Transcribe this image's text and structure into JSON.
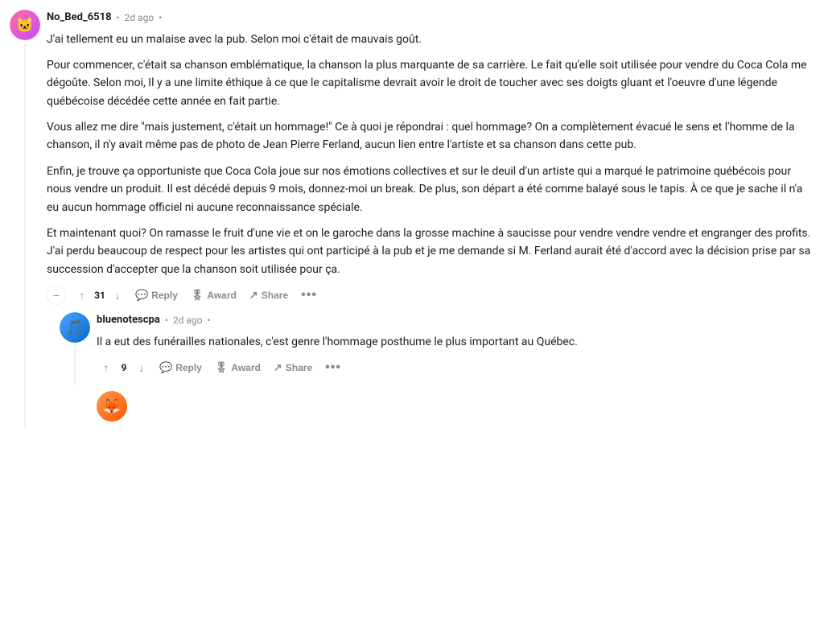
{
  "comments": [
    {
      "id": "main",
      "username": "No_Bed_6518",
      "timestamp": "2d ago",
      "avatarEmoji": "🐱",
      "avatarClass": "avatar-no-bed",
      "paragraphs": [
        "J'ai tellement eu un malaise avec la pub. Selon moi c'était de mauvais goût.",
        "Pour commencer, c'était sa chanson emblématique, la chanson la plus marquante de sa carrière. Le fait qu'elle soit utilisée pour vendre du Coca Cola me dégoûte. Selon moi, Il y a une limite éthique à ce que le capitalisme devrait avoir le droit de toucher avec ses doigts gluant et l'oeuvre d'une légende québécoise décédée cette année en fait partie.",
        "Vous allez me dire \"mais justement, c'était un hommage!\" Ce à quoi je répondrai : quel hommage? On a complètement évacué le sens et l'homme de la chanson, il n'y avait même pas de photo de Jean Pierre Ferland, aucun lien entre l'artiste et sa chanson dans cette pub.",
        "Enfin, je trouve ça opportuniste que Coca Cola joue sur nos émotions collectives et sur le deuil d'un artiste qui a marqué le patrimoine québécois pour nous vendre un produit. Il est décédé depuis 9 mois, donnez-moi un break. De plus, son départ a été comme balayé sous le tapis. À ce que je sache il n'a eu aucun hommage officiel ni aucune reconnaissance spéciale.",
        "Et maintenant quoi? On ramasse le fruit d'une vie et on le garoche dans la grosse machine à saucisse pour vendre vendre vendre et engranger des profits. J'ai perdu beaucoup de respect pour les artistes qui ont participé à la pub et je me demande si M. Ferland aurait été d'accord avec la décision prise par sa succession d'accepter que la chanson soit utilisée pour ça."
      ],
      "votes": 31,
      "actions": [
        "Reply",
        "Award",
        "Share"
      ]
    },
    {
      "id": "reply1",
      "username": "bluenotescpa",
      "timestamp": "2d ago",
      "avatarEmoji": "🎵",
      "avatarClass": "avatar-blue",
      "paragraphs": [
        "Il a eut des funérailles nationales, c'est genre l'hommage posthume le plus important au Québec."
      ],
      "votes": 9,
      "actions": [
        "Reply",
        "Award",
        "Share"
      ]
    }
  ],
  "ui": {
    "collapse_symbol": "−",
    "upvote_symbol": "↑",
    "downvote_symbol": "↓",
    "reply_icon": "💬",
    "award_icon": "🎖",
    "share_icon": "↗",
    "more_icon": "•••",
    "dot_separator": "•",
    "reply_label": "Reply",
    "award_label": "Award",
    "share_label": "Share"
  }
}
